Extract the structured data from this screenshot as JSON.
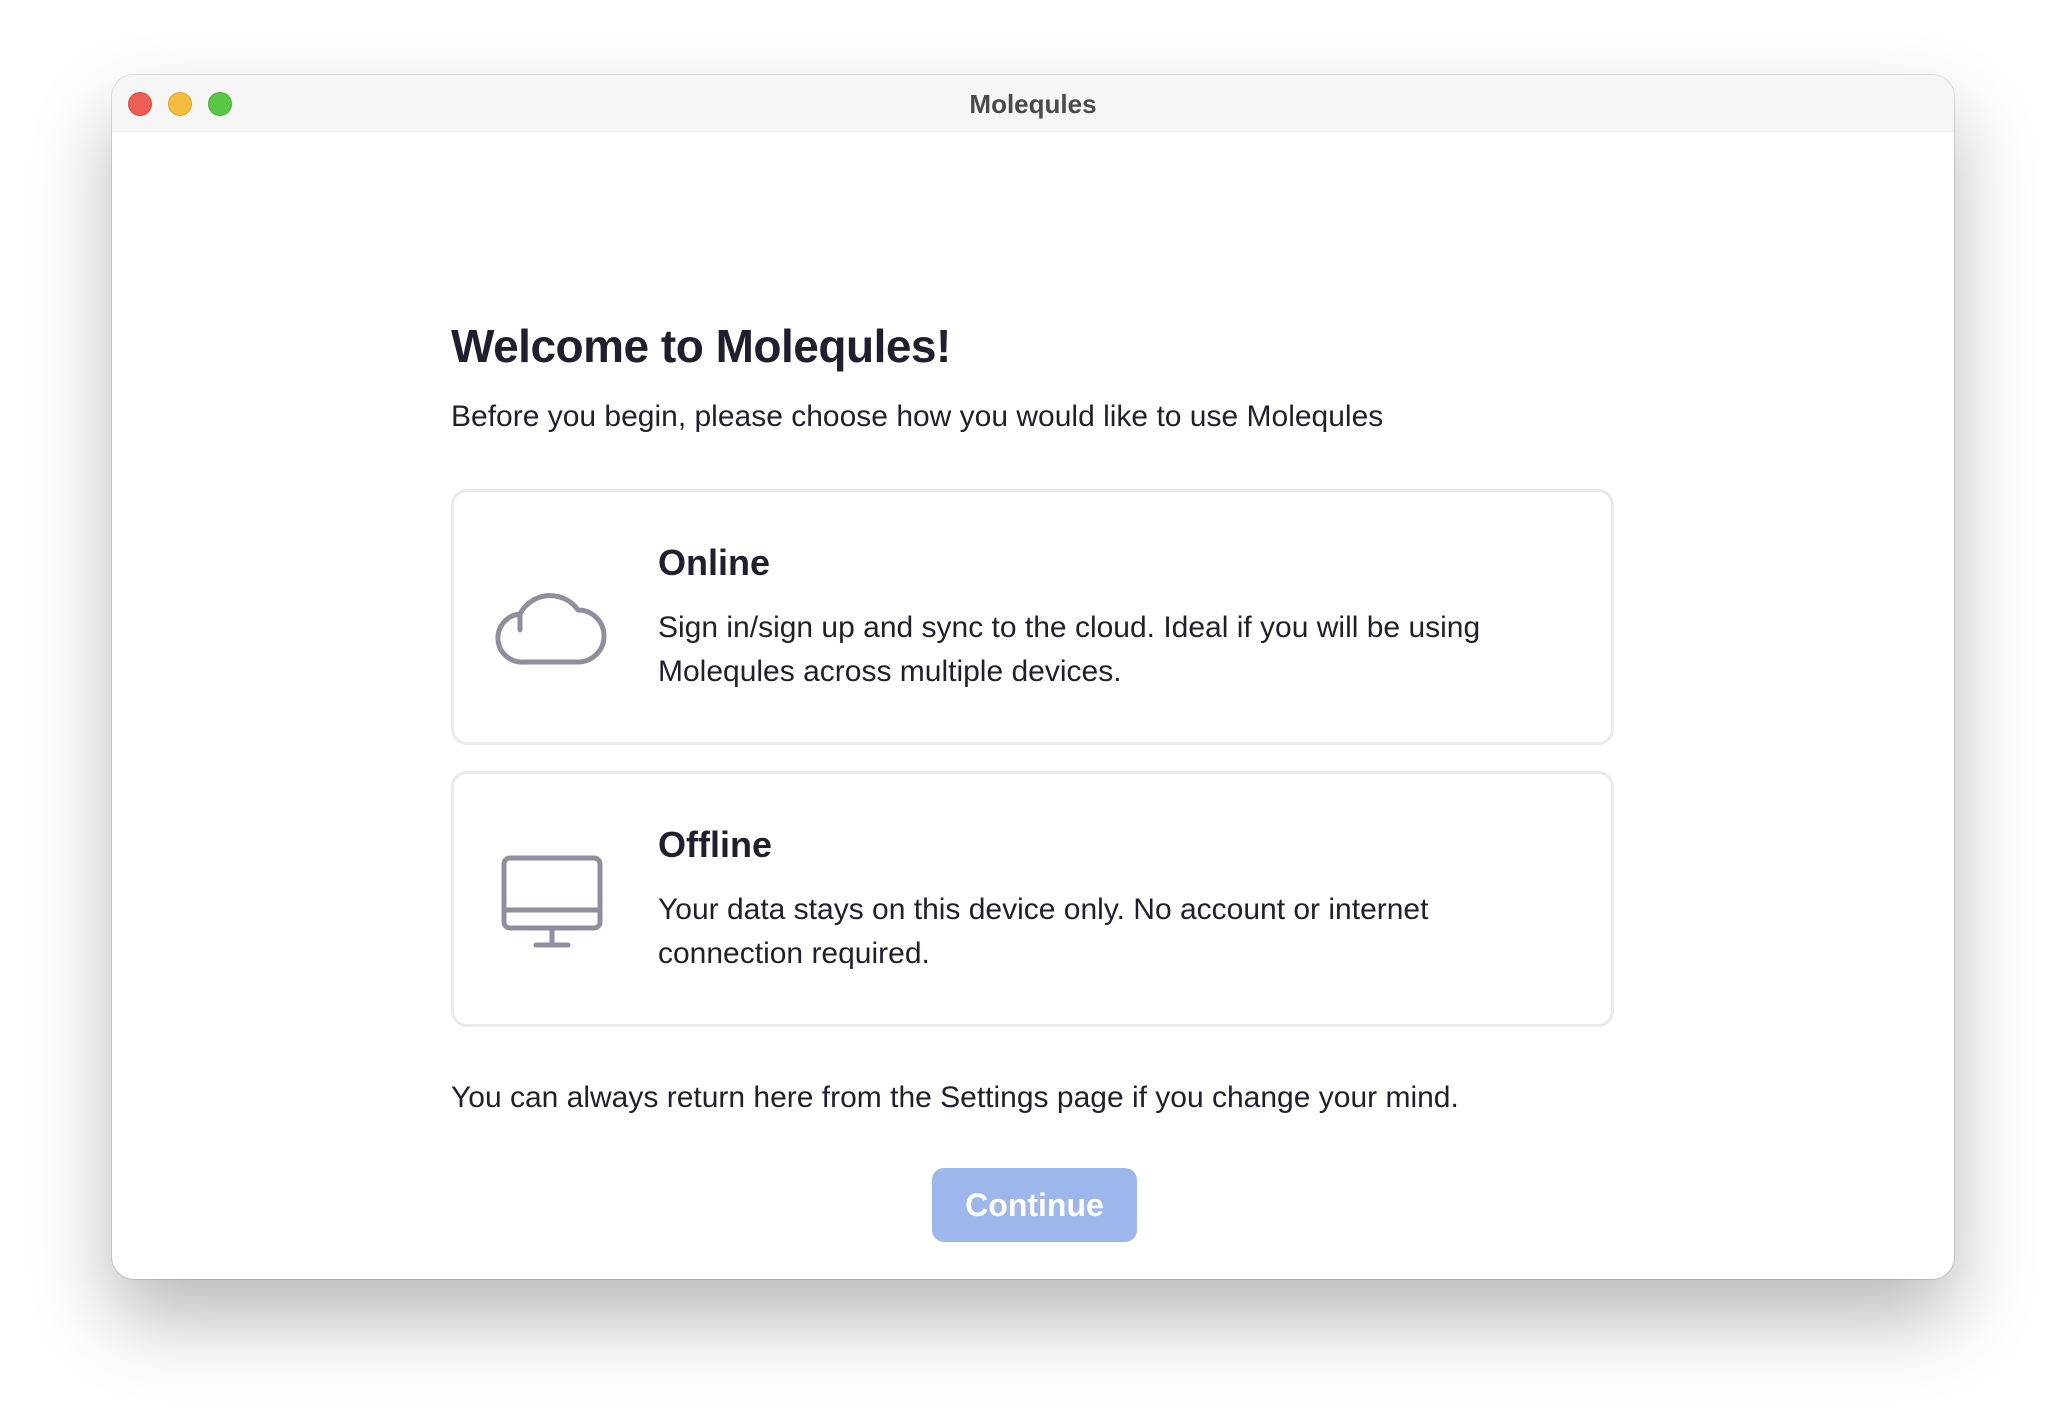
{
  "window": {
    "title": "Molequles"
  },
  "welcome": {
    "heading": "Welcome to Molequles!",
    "subtitle": "Before you begin, please choose how you would like to use Molequles"
  },
  "options": [
    {
      "title": "Online",
      "description": "Sign in/sign up and sync to the cloud. Ideal if you will be using Molequles across multiple devices.",
      "icon": "cloud-icon",
      "selected": false
    },
    {
      "title": "Offline",
      "description": "Your data stays on this device only. No account or internet connection required.",
      "icon": "desktop-icon",
      "selected": false
    }
  ],
  "footnote": "You can always return here from the Settings page if you change your mind.",
  "continue_button": {
    "label": "Continue",
    "disabled": true
  },
  "colors": {
    "text": "#1f1f2e",
    "icon": "#8e8e9c",
    "card_border": "#eaeaee",
    "button_disabled": "#9db6ec",
    "traffic_close": "#ee5e55",
    "traffic_minimize": "#f5bd3e",
    "traffic_zoom": "#5ac646"
  }
}
